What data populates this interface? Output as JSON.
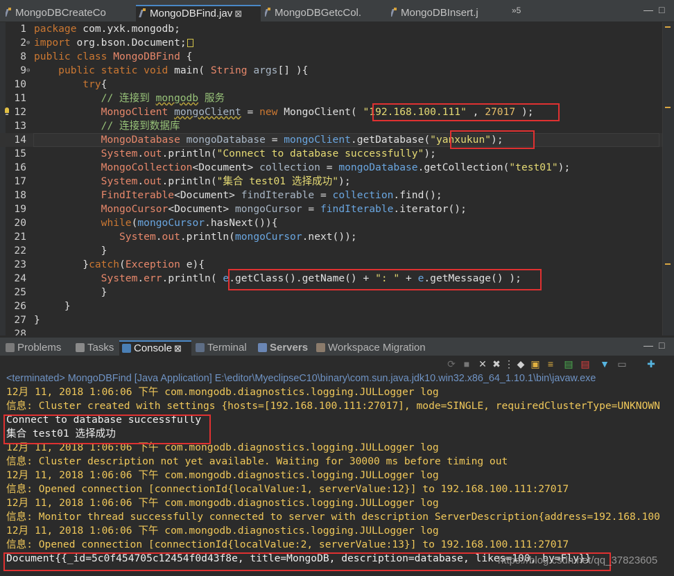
{
  "editor_tabs": [
    {
      "label": "MongoDBCreateCo",
      "active": false,
      "closable": false
    },
    {
      "label": "MongoDBFind.jav",
      "active": true,
      "closable": true
    },
    {
      "label": "MongoDBGetcCol.",
      "active": false,
      "closable": false
    },
    {
      "label": "MongoDBInsert.j",
      "active": false,
      "closable": false
    }
  ],
  "tab_overflow": "»5",
  "window_controls": {
    "minimize": "—",
    "maximize": "□"
  },
  "code": [
    {
      "n": "1",
      "fold": "",
      "segs": [
        [
          "kw",
          "package "
        ],
        [
          "plain",
          "com.yxk.mongodb;"
        ]
      ]
    },
    {
      "n": "2",
      "fold": "⊕",
      "segs": [
        [
          "kw",
          "import "
        ],
        [
          "plain",
          "org.bson.Document;"
        ]
      ],
      "collapsed": true
    },
    {
      "n": "8",
      "fold": "",
      "segs": [
        [
          "kw",
          "public class "
        ],
        [
          "type",
          "MongoDBFind"
        ],
        [
          "plain",
          " {"
        ]
      ]
    },
    {
      "n": "9",
      "fold": "⊖",
      "segs": [
        [
          "plain",
          "    "
        ],
        [
          "kw",
          "public static void "
        ],
        [
          "plain",
          "main( "
        ],
        [
          "type",
          "String "
        ],
        [
          "param",
          "args"
        ],
        [
          "plain",
          "[] ){"
        ]
      ]
    },
    {
      "n": "10",
      "fold": "",
      "segs": [
        [
          "plain",
          "        "
        ],
        [
          "kw",
          "try"
        ],
        [
          "plain",
          "{"
        ]
      ]
    },
    {
      "n": "11",
      "fold": "",
      "segs": [
        [
          "plain",
          "           "
        ],
        [
          "cmt",
          "// 连接到 "
        ],
        [
          "cmtsq",
          "mongodb"
        ],
        [
          "cmt",
          " 服务"
        ]
      ]
    },
    {
      "n": "12",
      "fold": "",
      "warn": true,
      "segs": [
        [
          "plain",
          "           "
        ],
        [
          "type",
          "MongoClient "
        ],
        [
          "varsq",
          "mongoClient"
        ],
        [
          "plain",
          " = "
        ],
        [
          "kw",
          "new "
        ],
        [
          "plain",
          "MongoClient( "
        ],
        [
          "str",
          "\"192.168.100.111\""
        ],
        [
          "plain",
          " , "
        ],
        [
          "num",
          "27017"
        ],
        [
          "plain",
          " );"
        ]
      ]
    },
    {
      "n": "13",
      "fold": "",
      "segs": [
        [
          "plain",
          "           "
        ],
        [
          "cmt",
          "// 连接到数据库"
        ]
      ]
    },
    {
      "n": "14",
      "fold": "",
      "current": true,
      "segs": [
        [
          "plain",
          "           "
        ],
        [
          "type",
          "MongoDatabase "
        ],
        [
          "var",
          "mongoDatabase"
        ],
        [
          "plain",
          " = "
        ],
        [
          "field",
          "mongoClient"
        ],
        [
          "plain",
          ".getDatabase("
        ],
        [
          "str",
          "\"yanxukun\""
        ],
        [
          "plain",
          ");"
        ]
      ]
    },
    {
      "n": "15",
      "fold": "",
      "segs": [
        [
          "plain",
          "           "
        ],
        [
          "type",
          "System"
        ],
        [
          "plain",
          "."
        ],
        [
          "type",
          "out"
        ],
        [
          "plain",
          ".println("
        ],
        [
          "str",
          "\"Connect to database successfully\""
        ],
        [
          "plain",
          ");"
        ]
      ]
    },
    {
      "n": "16",
      "fold": "",
      "segs": [
        [
          "plain",
          "           "
        ],
        [
          "type",
          "MongoCollection"
        ],
        [
          "plain",
          "<Document> "
        ],
        [
          "var",
          "collection"
        ],
        [
          "plain",
          " = "
        ],
        [
          "field",
          "mongoDatabase"
        ],
        [
          "plain",
          ".getCollection("
        ],
        [
          "str",
          "\"test01\""
        ],
        [
          "plain",
          ");"
        ]
      ]
    },
    {
      "n": "17",
      "fold": "",
      "segs": [
        [
          "plain",
          "           "
        ],
        [
          "type",
          "System"
        ],
        [
          "plain",
          "."
        ],
        [
          "type",
          "out"
        ],
        [
          "plain",
          ".println("
        ],
        [
          "str",
          "\"集合 test01 选择成功\""
        ],
        [
          "plain",
          ");"
        ]
      ]
    },
    {
      "n": "18",
      "fold": "",
      "segs": [
        [
          "plain",
          "           "
        ],
        [
          "type",
          "FindIterable"
        ],
        [
          "plain",
          "<Document> "
        ],
        [
          "var",
          "findIterable"
        ],
        [
          "plain",
          " = "
        ],
        [
          "field",
          "collection"
        ],
        [
          "plain",
          ".find();"
        ]
      ]
    },
    {
      "n": "19",
      "fold": "",
      "segs": [
        [
          "plain",
          "           "
        ],
        [
          "type",
          "MongoCursor"
        ],
        [
          "plain",
          "<Document> "
        ],
        [
          "var",
          "mongoCursor"
        ],
        [
          "plain",
          " = "
        ],
        [
          "field",
          "findIterable"
        ],
        [
          "plain",
          ".iterator();"
        ]
      ]
    },
    {
      "n": "20",
      "fold": "",
      "segs": [
        [
          "plain",
          "           "
        ],
        [
          "kw",
          "while"
        ],
        [
          "plain",
          "("
        ],
        [
          "field",
          "mongoCursor"
        ],
        [
          "plain",
          ".hasNext()){"
        ]
      ]
    },
    {
      "n": "21",
      "fold": "",
      "segs": [
        [
          "plain",
          "              "
        ],
        [
          "type",
          "System"
        ],
        [
          "plain",
          "."
        ],
        [
          "type",
          "out"
        ],
        [
          "plain",
          ".println("
        ],
        [
          "field",
          "mongoCursor"
        ],
        [
          "plain",
          ".next());"
        ]
      ]
    },
    {
      "n": "22",
      "fold": "",
      "segs": [
        [
          "plain",
          "           }"
        ]
      ]
    },
    {
      "n": "23",
      "fold": "",
      "segs": [
        [
          "plain",
          "        }"
        ],
        [
          "kw",
          "catch"
        ],
        [
          "plain",
          "("
        ],
        [
          "type",
          "Exception "
        ],
        [
          "plain",
          "e){"
        ]
      ]
    },
    {
      "n": "24",
      "fold": "",
      "segs": [
        [
          "plain",
          "           "
        ],
        [
          "type",
          "System"
        ],
        [
          "plain",
          "."
        ],
        [
          "type",
          "err"
        ],
        [
          "plain",
          ".println( "
        ],
        [
          "field",
          "e"
        ],
        [
          "plain",
          ".getClass().getName() + "
        ],
        [
          "str",
          "\": \""
        ],
        [
          "plain",
          " + "
        ],
        [
          "field",
          "e"
        ],
        [
          "plain",
          ".getMessage() );"
        ]
      ]
    },
    {
      "n": "25",
      "fold": "",
      "segs": [
        [
          "plain",
          "           }"
        ]
      ]
    },
    {
      "n": "26",
      "fold": "",
      "segs": [
        [
          "plain",
          "     }"
        ]
      ]
    },
    {
      "n": "27",
      "fold": "",
      "segs": [
        [
          "plain",
          "}"
        ]
      ]
    },
    {
      "n": "28",
      "fold": "",
      "segs": []
    }
  ],
  "panel_tabs": [
    {
      "label": "Problems",
      "active": false,
      "icon": "problems-icon",
      "color": "#7a7a7a",
      "closable": false
    },
    {
      "label": "Tasks",
      "active": false,
      "icon": "tasks-icon",
      "color": "#8a8a8a",
      "closable": false
    },
    {
      "label": "Console",
      "active": true,
      "icon": "console-icon",
      "color": "#4a7fb5",
      "closable": true
    },
    {
      "label": "Terminal",
      "active": false,
      "icon": "terminal-icon",
      "color": "#5e6e86",
      "closable": false
    },
    {
      "label": "Servers",
      "active": false,
      "icon": "servers-icon",
      "color": "#6a86b4",
      "closable": false,
      "bold": true
    },
    {
      "label": "Workspace Migration",
      "active": false,
      "icon": "migration-icon",
      "color": "#8b7b6b",
      "closable": false
    }
  ],
  "console_header": "<terminated> MongoDBFind [Java Application] E:\\editor\\MyeclipseC10\\binary\\com.sun.java.jdk10.win32.x86_64_1.10.1\\bin\\javaw.exe",
  "console_lines": [
    {
      "style": "red",
      "text": "12月 11, 2018 1:06:06 下午 com.mongodb.diagnostics.logging.JULLogger log"
    },
    {
      "style": "red",
      "text": "信息: Cluster created with settings {hosts=[192.168.100.111:27017], mode=SINGLE, requiredClusterType=UNKNOWN"
    },
    {
      "style": "white",
      "text": "Connect to database successfully"
    },
    {
      "style": "white",
      "text": "集合 test01 选择成功"
    },
    {
      "style": "red",
      "text": "12月 11, 2018 1:06:06 下午 com.mongodb.diagnostics.logging.JULLogger log"
    },
    {
      "style": "red",
      "text": "信息: Cluster description not yet available. Waiting for 30000 ms before timing out"
    },
    {
      "style": "red",
      "text": "12月 11, 2018 1:06:06 下午 com.mongodb.diagnostics.logging.JULLogger log"
    },
    {
      "style": "red",
      "text": "信息: Opened connection [connectionId{localValue:1, serverValue:12}] to 192.168.100.111:27017"
    },
    {
      "style": "red",
      "text": "12月 11, 2018 1:06:06 下午 com.mongodb.diagnostics.logging.JULLogger log"
    },
    {
      "style": "red",
      "text": "信息: Monitor thread successfully connected to server with description ServerDescription{address=192.168.100"
    },
    {
      "style": "red",
      "text": "12月 11, 2018 1:06:06 下午 com.mongodb.diagnostics.logging.JULLogger log"
    },
    {
      "style": "red",
      "text": "信息: Opened connection [connectionId{localValue:2, serverValue:13}] to 192.168.100.111:27017"
    },
    {
      "style": "white",
      "text": "Document{{_id=5c0f454705c12454f0d43f8e, title=MongoDB, description=database, likes=100, by=Fly}}"
    }
  ],
  "watermark": "https://blog.csdn.net/qq_37823605",
  "colors": {
    "accent": "#4a88c7",
    "highlight_box": "#e03131"
  }
}
